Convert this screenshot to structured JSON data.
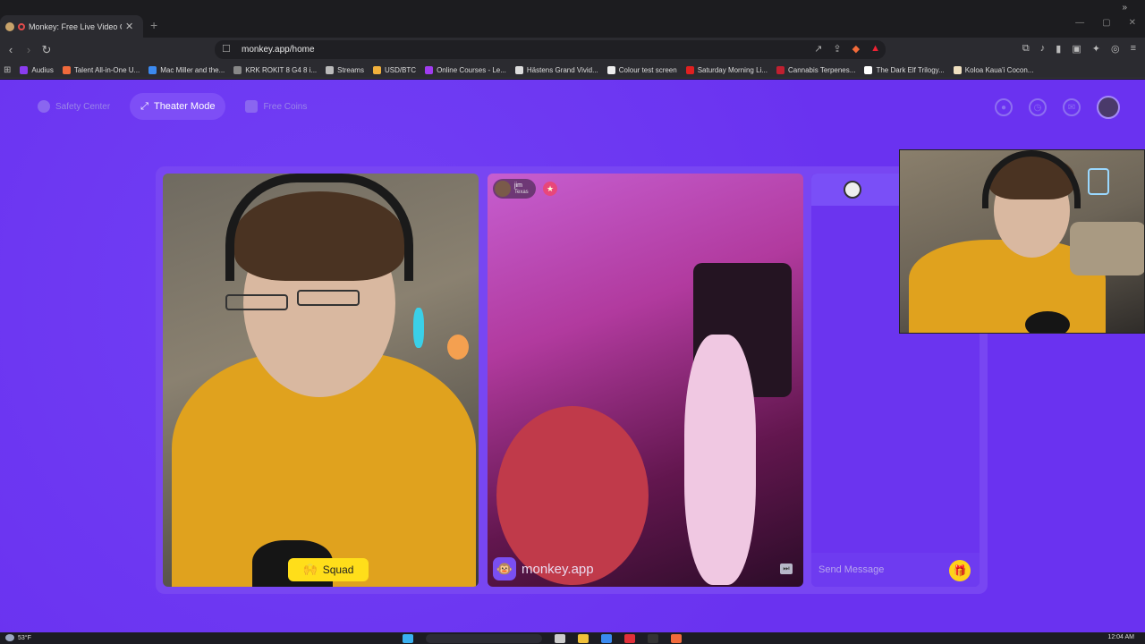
{
  "browser": {
    "tab_title": "Monkey: Free Live Video Cha",
    "url": "monkey.app/home",
    "bookmarks": [
      {
        "label": "Audius",
        "color": "#8a3cf0"
      },
      {
        "label": "Talent All-in-One U...",
        "color": "#f06a3c"
      },
      {
        "label": "Mac Miller and the...",
        "color": "#3c8af0"
      },
      {
        "label": "KRK ROKIT 8 G4 8 i...",
        "color": "#888888"
      },
      {
        "label": "Streams",
        "color": "#bbbbbb"
      },
      {
        "label": "USD/BTC",
        "color": "#f0b03c"
      },
      {
        "label": "Online Courses - Le...",
        "color": "#a03cf0"
      },
      {
        "label": "Hästens Grand Vivid...",
        "color": "#dddddd"
      },
      {
        "label": "Colour test screen",
        "color": "#eeeeee"
      },
      {
        "label": "Saturday Morning Li...",
        "color": "#e02020"
      },
      {
        "label": "Cannabis Terpenes...",
        "color": "#c02030"
      },
      {
        "label": "The Dark Elf Trilogy...",
        "color": "#ffffff"
      },
      {
        "label": "Koloa Kaua'i Cocon...",
        "color": "#f0e0c0"
      }
    ]
  },
  "nav": {
    "safety_center": "Safety Center",
    "theater_mode": "Theater Mode",
    "free_coins": "Free Coins"
  },
  "video": {
    "squad_label": "Squad",
    "remote_name": "jim",
    "remote_location": "Texas",
    "brand": "monkey.app"
  },
  "chat": {
    "placeholder": "Send Message"
  },
  "taskbar": {
    "weather": "53°F",
    "time": "12:04 AM"
  },
  "colors": {
    "page_bg": "#6a32f0",
    "squad_yellow": "#ffde1a"
  }
}
